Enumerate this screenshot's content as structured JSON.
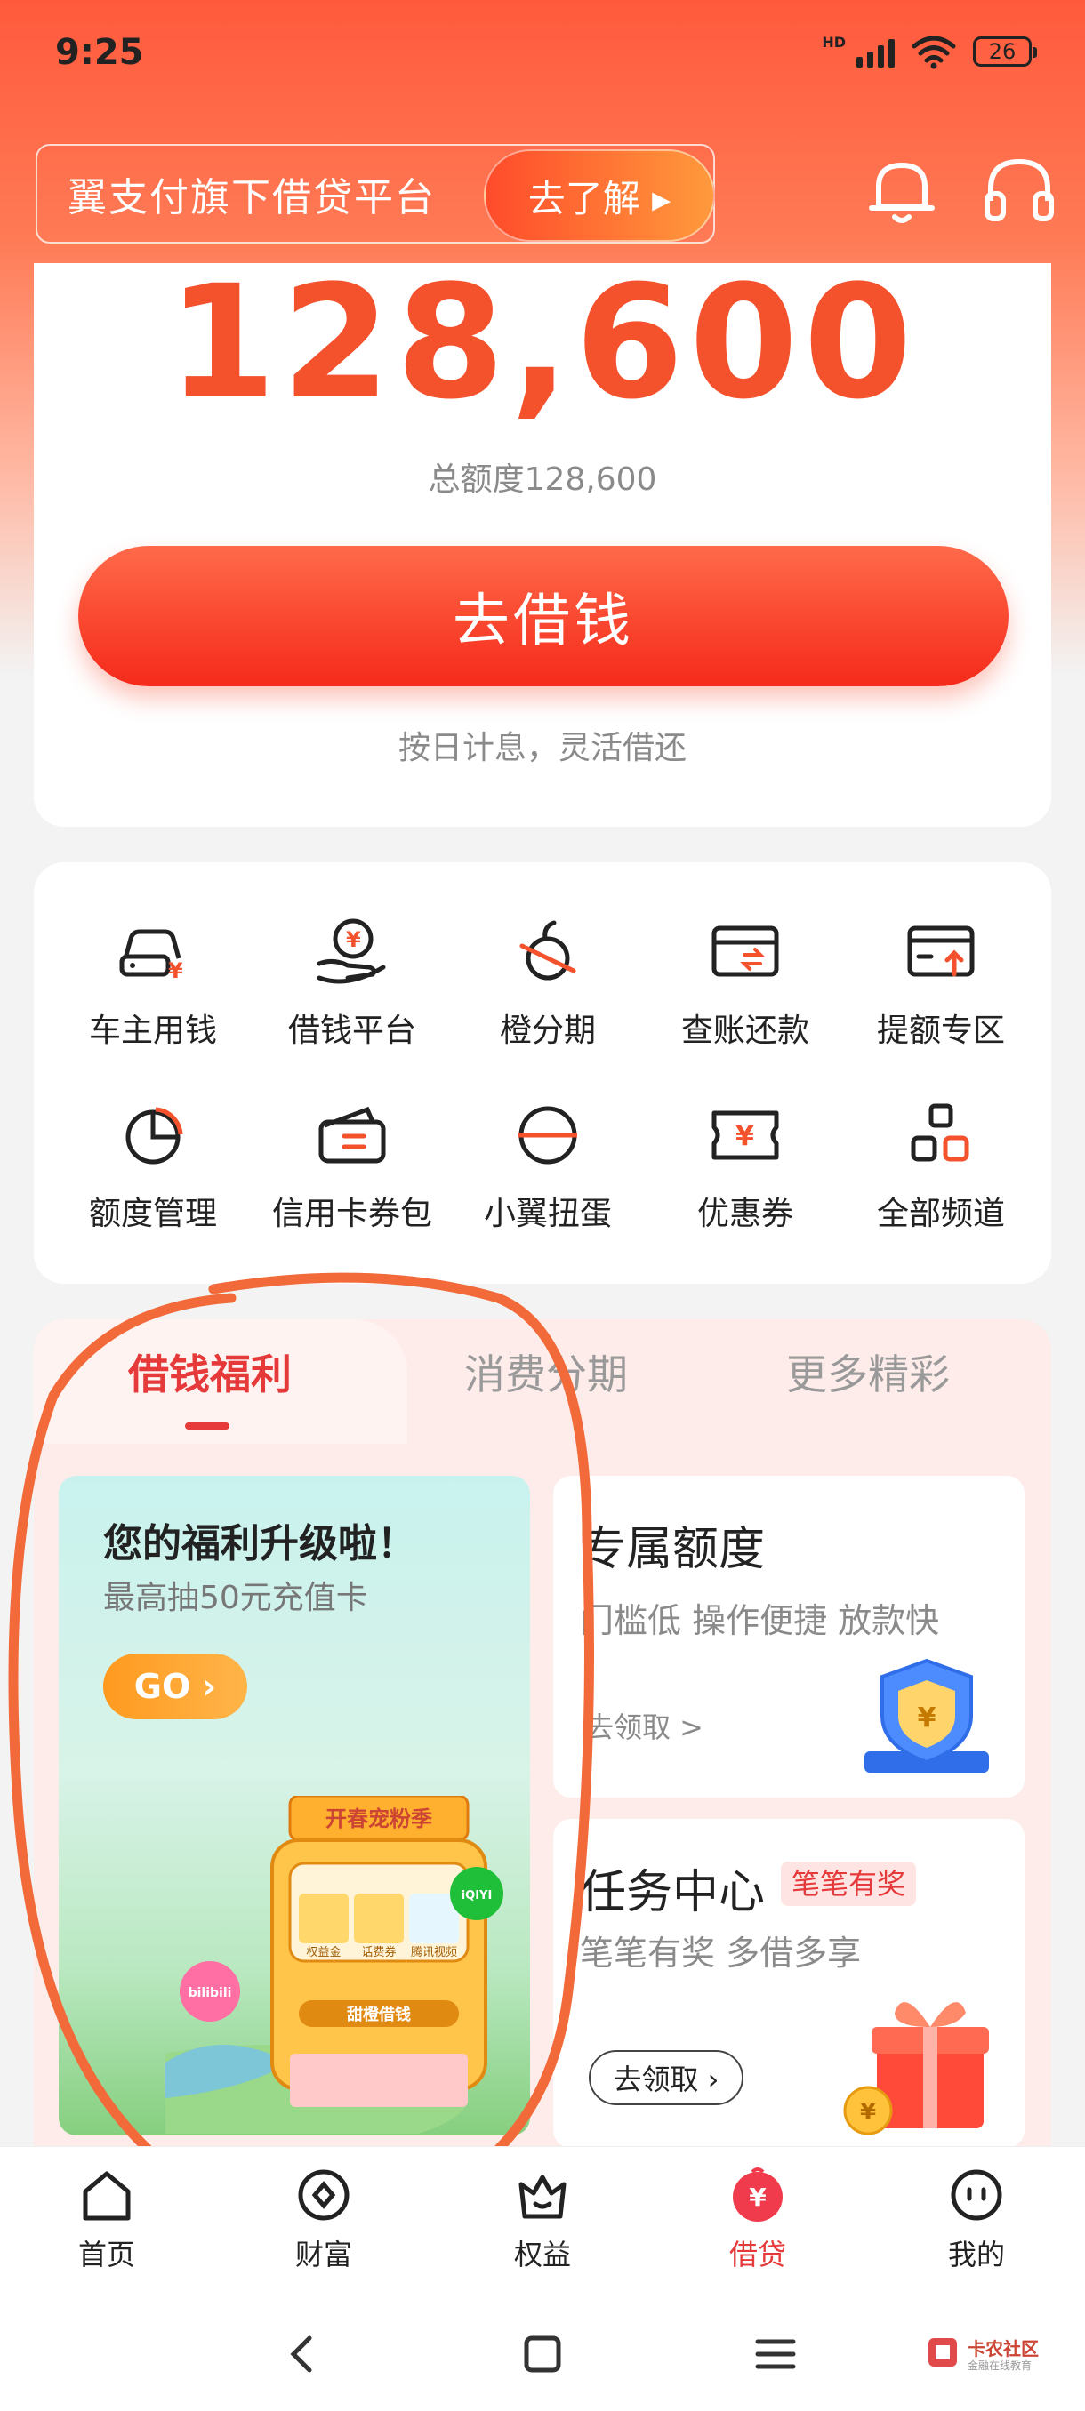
{
  "status_bar": {
    "time": "9:25",
    "network": "HD",
    "battery": "26"
  },
  "header": {
    "promo_text": "翼支付旗下借贷平台",
    "promo_button": "去了解 ▸"
  },
  "credit": {
    "amount": "128,600",
    "total_label": "总额度128,600",
    "borrow_button": "去借钱",
    "borrow_note": "按日计息，灵活借还"
  },
  "services": [
    {
      "label": "车主用钱",
      "icon": "car-money-icon"
    },
    {
      "label": "借钱平台",
      "icon": "hand-coin-icon"
    },
    {
      "label": "橙分期",
      "icon": "orange-installment-icon"
    },
    {
      "label": "查账还款",
      "icon": "bill-repay-icon"
    },
    {
      "label": "提额专区",
      "icon": "limit-raise-icon"
    },
    {
      "label": "额度管理",
      "icon": "pie-chart-icon"
    },
    {
      "label": "信用卡券包",
      "icon": "card-wallet-icon"
    },
    {
      "label": "小翼扭蛋",
      "icon": "capsule-icon"
    },
    {
      "label": "优惠券",
      "icon": "coupon-icon"
    },
    {
      "label": "全部频道",
      "icon": "all-channels-icon"
    }
  ],
  "tabs": [
    "借钱福利",
    "消费分期",
    "更多精彩"
  ],
  "welfare": {
    "title": "您的福利升级啦！",
    "subtitle": "最高抽50元充值卡",
    "go_button": "GO ›",
    "machine_banner": "开春宠粉季",
    "machine_brand": "甜橙借钱",
    "machine_items": [
      "权益金",
      "话费券",
      "腾讯视频"
    ],
    "badge_left": "bilibili",
    "badge_right": "iQIYI"
  },
  "exclusive": {
    "title": "专属额度",
    "subtitle": "门槛低 操作便捷 放款快",
    "link": "去领取 >"
  },
  "task": {
    "title": "任务中心",
    "badge": "笔笔有奖",
    "subtitle": "笔笔有奖 多借多享",
    "button": "去领取 ›"
  },
  "bottom_nav": [
    {
      "label": "首页",
      "icon": "home-icon"
    },
    {
      "label": "财富",
      "icon": "wealth-icon"
    },
    {
      "label": "权益",
      "icon": "benefits-icon"
    },
    {
      "label": "借贷",
      "icon": "loan-icon"
    },
    {
      "label": "我的",
      "icon": "profile-icon"
    }
  ],
  "watermark": {
    "text": "卡农社区",
    "sub": "金融在线教育"
  },
  "colors": {
    "accent": "#f4512d",
    "active_red": "#e5393a",
    "annotation": "#f26a3a"
  }
}
